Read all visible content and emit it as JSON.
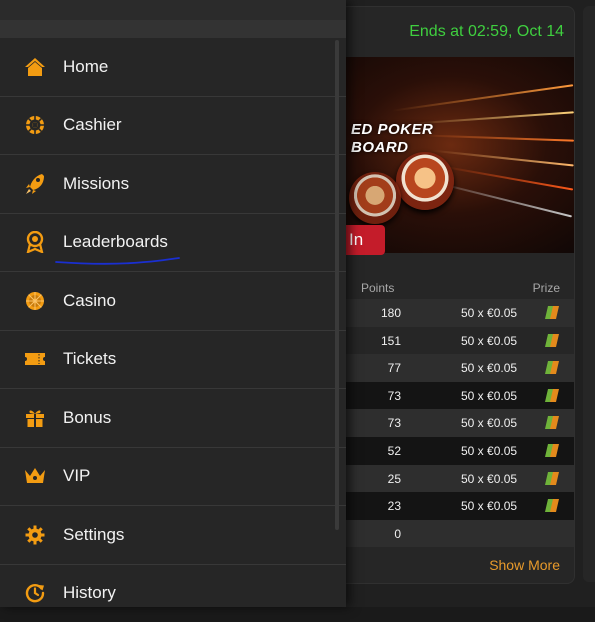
{
  "accent": "#f39c12",
  "card": {
    "ends_text": "Ends at 02:59, Oct 14",
    "banner_line1": "ED POKER",
    "banner_line2": "BOARD",
    "join_label": "In",
    "show_more_label": "Show More"
  },
  "table": {
    "headers": {
      "points": "Points",
      "prize": "Prize"
    },
    "rows": [
      {
        "points": "180",
        "prize": "50 x €0.05"
      },
      {
        "points": "151",
        "prize": "50 x €0.05"
      },
      {
        "points": "77",
        "prize": "50 x €0.05"
      },
      {
        "points": "73",
        "prize": "50 x €0.05"
      },
      {
        "points": "73",
        "prize": "50 x €0.05"
      },
      {
        "points": "52",
        "prize": "50 x €0.05"
      },
      {
        "points": "25",
        "prize": "50 x €0.05"
      },
      {
        "points": "23",
        "prize": "50 x €0.05"
      },
      {
        "points": "0",
        "prize": ""
      }
    ]
  },
  "menu": {
    "items": [
      {
        "label": "Home",
        "icon": "home-icon"
      },
      {
        "label": "Cashier",
        "icon": "wheel-icon"
      },
      {
        "label": "Missions",
        "icon": "rocket-icon"
      },
      {
        "label": "Leaderboards",
        "icon": "ribbon-award-icon"
      },
      {
        "label": "Casino",
        "icon": "roulette-icon"
      },
      {
        "label": "Tickets",
        "icon": "ticket-icon"
      },
      {
        "label": "Bonus",
        "icon": "gift-icon"
      },
      {
        "label": "VIP",
        "icon": "crown-icon"
      },
      {
        "label": "Settings",
        "icon": "gear-icon"
      },
      {
        "label": "History",
        "icon": "history-icon"
      }
    ]
  }
}
